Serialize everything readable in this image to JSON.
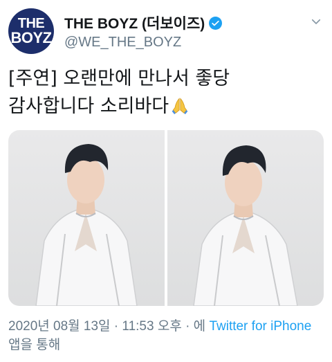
{
  "header": {
    "avatar_line1": "THE",
    "avatar_line2": "BOYZ",
    "avatar_small": "THE",
    "display_name": "THE BOYZ (더보이즈)",
    "handle": "@WE_THE_BOYZ"
  },
  "tweet": {
    "line1": "[주연] 오랜만에 만나서 좋당",
    "line2": "감사합니다 소리바다",
    "emoji": "folded-hands-emoji"
  },
  "media": {
    "count": 2
  },
  "meta": {
    "date_time": "2020년 08월 13일 · 11:53 오후 · 에 ",
    "source_link": "Twitter for iPhone",
    "suffix": " 앱을 통해"
  },
  "colors": {
    "accent": "#1da1f2",
    "secondary_text": "#657786",
    "avatar_bg": "#1d2e6b"
  }
}
